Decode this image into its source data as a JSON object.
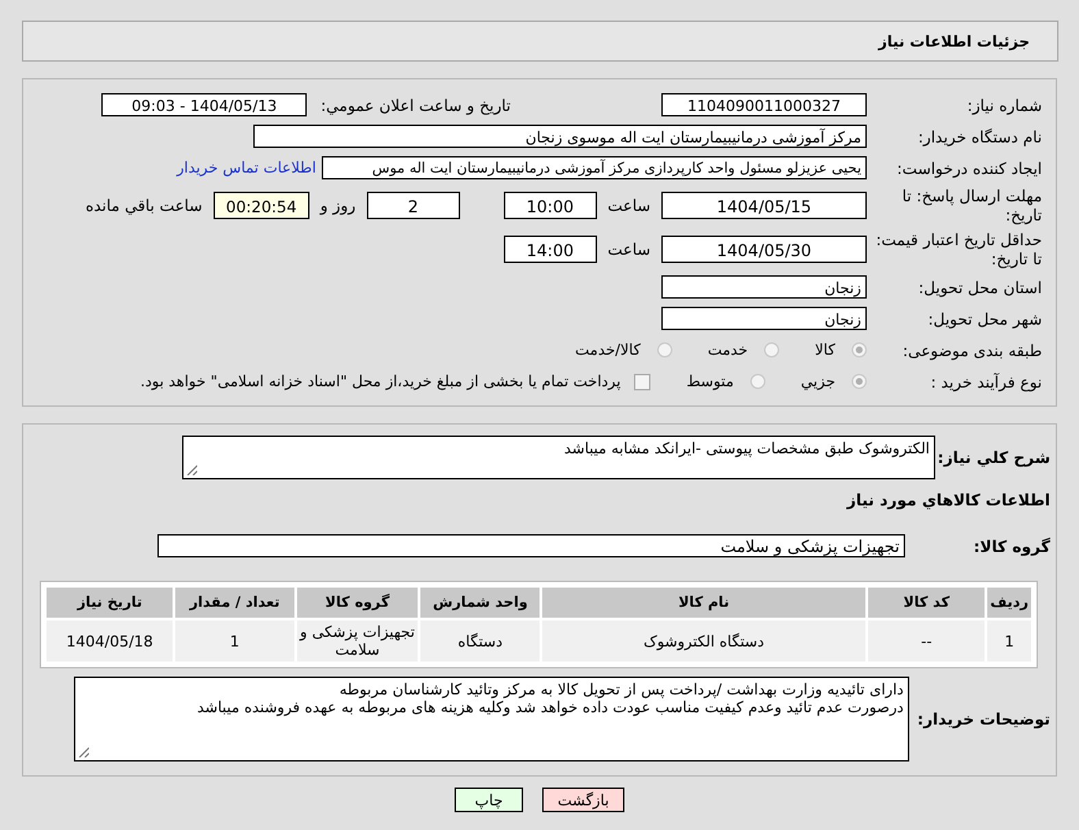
{
  "header": {
    "title": "جزئیات اطلاعات نیاز"
  },
  "need_number": {
    "label": "شماره نیاز:",
    "value": "1104090011000327"
  },
  "announce": {
    "label": "تاریخ و ساعت اعلان عمومي:",
    "value": "1404/05/13 - 09:03"
  },
  "buyer_org": {
    "label": "نام دستگاه خریدار:",
    "value": "مرکز آموزشی درمانیبیمارستان ایت اله موسوی زنجان"
  },
  "creator": {
    "label": "ایجاد کننده درخواست:",
    "value": "یحیی عزیزلو مسئول واحد کارپردازی مرکز آموزشی درمانیبیمارستان ایت اله موس",
    "link": "اطلاعات تماس خریدار"
  },
  "reply_deadline": {
    "label": "مهلت ارسال پاسخ: تا تاریخ:",
    "date": "1404/05/15",
    "time_label": "ساعت",
    "time": "10:00",
    "days": "2",
    "days_label": "روز و",
    "remaining": "00:20:54",
    "remaining_label": "ساعت باقي مانده"
  },
  "price_validity": {
    "label": "حداقل تاریخ اعتبار قیمت: تا تاریخ:",
    "date": "1404/05/30",
    "time_label": "ساعت",
    "time": "14:00"
  },
  "province": {
    "label": "استان محل تحویل:",
    "value": "زنجان"
  },
  "city": {
    "label": "شهر محل تحویل:",
    "value": "زنجان"
  },
  "category": {
    "label": "طبقه بندی موضوعی:",
    "options": [
      {
        "label": "کالا",
        "selected": true
      },
      {
        "label": "خدمت",
        "selected": false
      },
      {
        "label": "کالا/خدمت",
        "selected": false
      }
    ]
  },
  "purchase_type": {
    "label": "نوع فرآیند خرید :",
    "options": [
      {
        "label": "جزیي",
        "selected": true
      },
      {
        "label": "متوسط",
        "selected": false
      }
    ],
    "treasury": {
      "label": "پرداخت تمام یا بخشی از مبلغ خرید،از محل \"اسناد خزانه اسلامی\" خواهد بود.",
      "checked": false
    }
  },
  "description": {
    "label": "شرح کلي نیاز:",
    "value": "الکتروشوک طبق مشخصات پیوستی -ایرانکد مشابه میباشد"
  },
  "goods_section": {
    "title": "اطلاعات کالاهاي مورد نیاز"
  },
  "goods_group": {
    "label": "گروه کالا:",
    "value": "تجهیزات پزشکی و سلامت"
  },
  "table": {
    "columns": [
      "ردیف",
      "کد کالا",
      "نام کالا",
      "واحد شمارش",
      "گروه کالا",
      "تعداد / مقدار",
      "تاریخ نیاز"
    ],
    "rows": [
      [
        "1",
        "--",
        "دستگاه الکتروشوک",
        "دستگاه",
        "تجهیزات پزشکی و سلامت",
        "1",
        "1404/05/18"
      ]
    ]
  },
  "buyer_notes": {
    "label": "توضیحات خریدار:",
    "value": "دارای تائیدیه وزارت بهداشت /پرداخت پس از تحویل کالا به مرکز وتائید کارشناسان مربوطه\nدرصورت عدم تائید وعدم کیفیت مناسب عودت داده خواهد شد وکلیه هزینه های مربوطه به عهده فروشنده میباشد"
  },
  "buttons": [
    {
      "label": "بازگشت",
      "kind": "back"
    },
    {
      "label": "چاپ",
      "kind": "print"
    }
  ]
}
